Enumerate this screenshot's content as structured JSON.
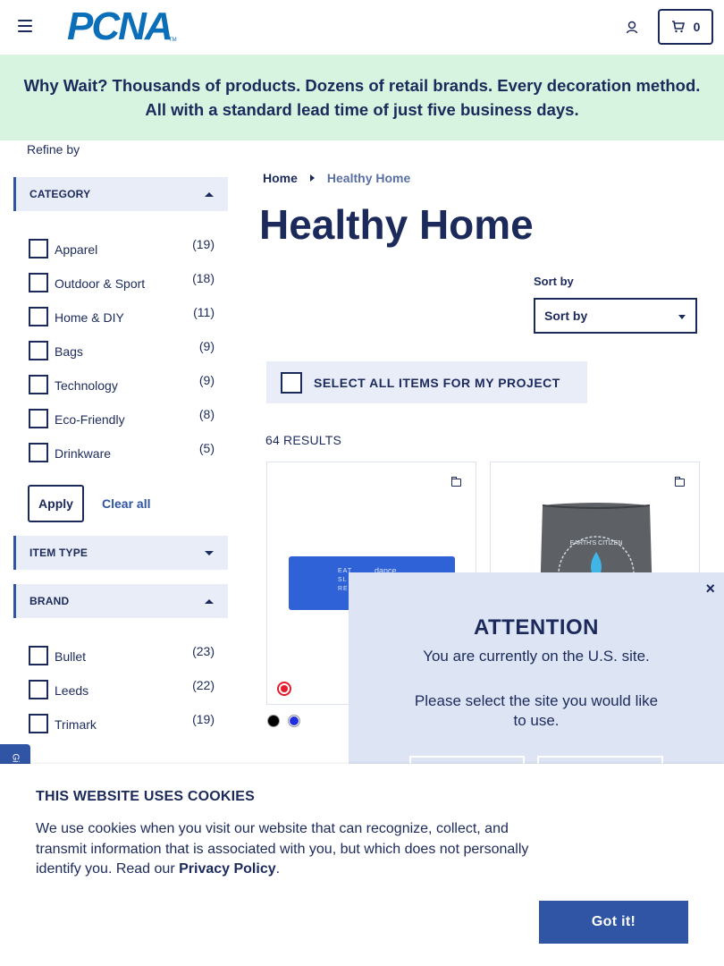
{
  "header": {
    "logo_text": "PCNA",
    "logo_tm": "TM",
    "cart_count": "0"
  },
  "banner": {
    "text": "Why Wait? Thousands of products. Dozens of retail brands. Every decoration method. All with a standard lead time of just five business days."
  },
  "sidebar": {
    "refine_label": "Refine by",
    "category": {
      "title": "CATEGORY",
      "items": [
        {
          "label": "Apparel",
          "count": "(19)"
        },
        {
          "label": "Outdoor & Sport",
          "count": "(18)"
        },
        {
          "label": "Home & DIY",
          "count": "(11)"
        },
        {
          "label": "Bags",
          "count": "(9)"
        },
        {
          "label": "Technology",
          "count": "(9)"
        },
        {
          "label": "Eco-Friendly",
          "count": "(8)"
        },
        {
          "label": "Drinkware",
          "count": "(5)"
        }
      ],
      "apply_label": "Apply",
      "clear_label": "Clear all"
    },
    "item_type": {
      "title": "ITEM TYPE"
    },
    "brand": {
      "title": "BRAND",
      "items": [
        {
          "label": "Bullet",
          "count": "(23)"
        },
        {
          "label": "Leeds",
          "count": "(22)"
        },
        {
          "label": "Trimark",
          "count": "(19)"
        }
      ]
    }
  },
  "main": {
    "breadcrumb": {
      "home": "Home",
      "current": "Healthy Home"
    },
    "title": "Healthy Home",
    "sort": {
      "label": "Sort by",
      "selected": "Sort by"
    },
    "select_all_label": "SELECT ALL ITEMS FOR MY PROJECT",
    "results_label": "64 RESULTS",
    "products": [
      {
        "imprint_lines": [
          "EAT",
          "SL",
          "RE"
        ],
        "imprint_brand": "dance",
        "swatches": [
          "#000000",
          "#1f2fe0"
        ]
      },
      {
        "imprint_text": "EARTH'S CITIZEN"
      }
    ]
  },
  "modal": {
    "close": "×",
    "title": "ATTENTION",
    "message1": "You are currently on the U.S. site.",
    "message2": "Please select the site you would like to use."
  },
  "side_tab": {
    "label": "Gi"
  },
  "cookie": {
    "heading": "THIS WEBSITE USES COOKIES",
    "body": "We use cookies when you visit our website that can recognize, collect, and transmit information that is associated with you, but which does not personally identify you. Read our ",
    "link": "Privacy Policy",
    "body_end": ".",
    "button": "Got it!"
  }
}
